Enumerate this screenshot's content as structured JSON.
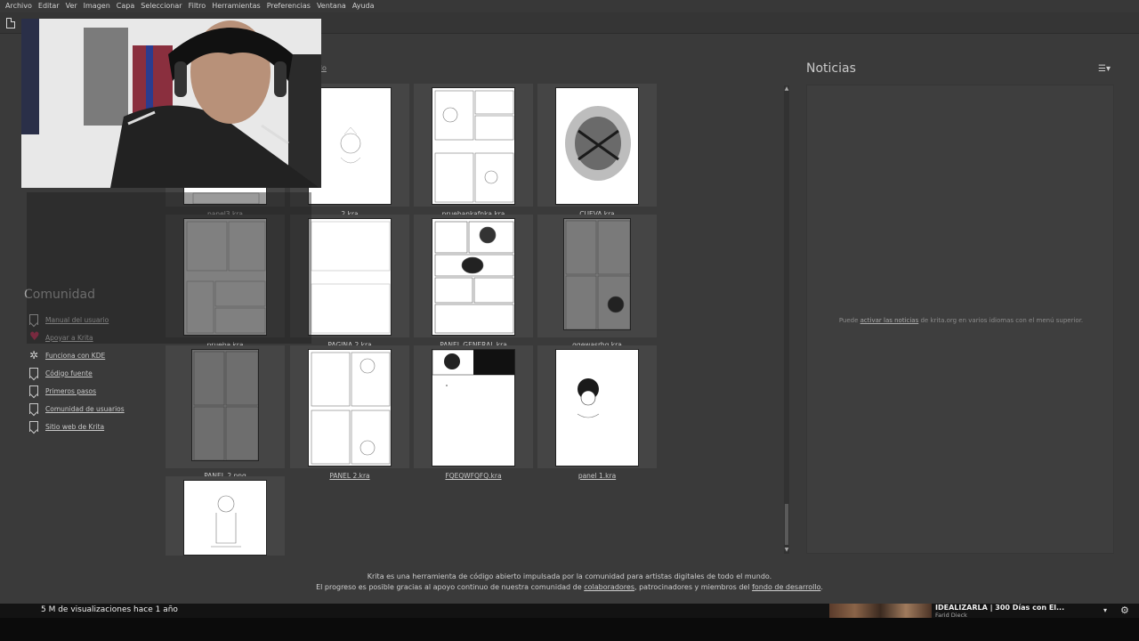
{
  "menu": [
    "Archivo",
    "Editar",
    "Ver",
    "Imagen",
    "Capa",
    "Seleccionar",
    "Filtro",
    "Herramientas",
    "Preferencias",
    "Ventana",
    "Ayuda"
  ],
  "recent": {
    "header_partial": "ado",
    "files": [
      "panel3.kra",
      "2.kra",
      "pruebankafnka.kra",
      "CUEVA.kra",
      "prueba.kra",
      "PAGINA 2.kra",
      "PANEL GENERAL.kra",
      "qqewasrhg.kra",
      "PANEL 2.png",
      "PANEL 2.kra",
      "FQEQWFQFQ.kra",
      "panel 1.kra",
      ""
    ]
  },
  "community": {
    "title": "Comunidad",
    "links": [
      "Manual del usuario",
      "Apoyar a Krita",
      "Funciona con KDE",
      "Código fuente",
      "Primeros pasos",
      "Comunidad de usuarios",
      "Sitio web de Krita"
    ]
  },
  "news": {
    "title": "Noticias",
    "msg_pre": "Puede ",
    "msg_link": "activar las noticias",
    "msg_post": " de krita.org en varios idiomas con el menú superior."
  },
  "footer": {
    "line1": "Krita es una herramienta de código abierto impulsada por la comunidad para artistas digitales de todo el mundo.",
    "line2_a": "El progreso es posible gracias al apoyo continuo de nuestra comunidad de ",
    "link_collab": "colaboradores",
    "line2_b": ", patrocinadores y miembros del ",
    "link_fund": "fondo de desarrollo",
    "line2_c": "."
  },
  "youtube": {
    "views": "5 M de visualizaciones  hace 1 año",
    "rec_title": "IDEALIZARLA | 300 Días con El...",
    "rec_channel": "Farid Dieck"
  }
}
